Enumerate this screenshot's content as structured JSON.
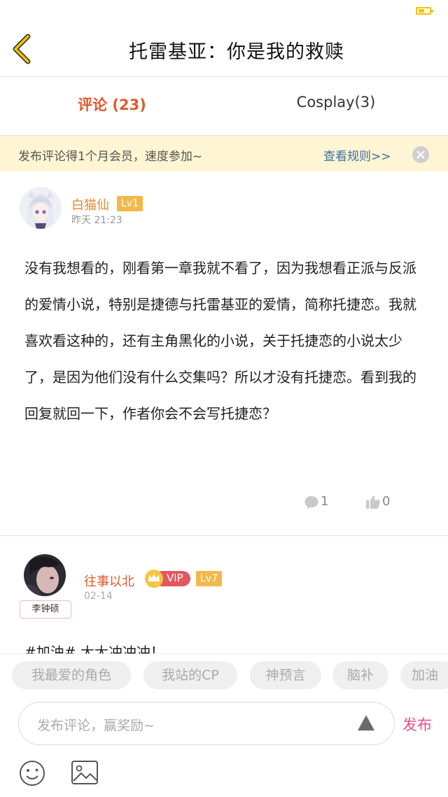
{
  "header": {
    "title": "托雷基亚：你是我的救赎"
  },
  "tabs": {
    "comments": "评论 (23)",
    "cosplay": "Cosplay(3)"
  },
  "notice": {
    "text": "发布评论得1个月会员，速度参加~",
    "link": "查看规则>>"
  },
  "comments": [
    {
      "username": "白猫仙",
      "level": "Lv1",
      "time": "昨天 21:23",
      "body": "没有我想看的，刚看第一章我就不看了，因为我想看正派与反派的爱情小说，特别是捷德与托雷基亚的爱情，简称托捷恋。我就喜欢看这种的，还有主角黑化的小说，关于托捷恋的小说太少了，是因为他们没有什么交集吗？所以才没有托捷恋。看到我的回复就回一下，作者你会不会写托捷恋？",
      "reply_count": "1",
      "like_count": "0"
    },
    {
      "username": "往事以北",
      "vip": "VIP",
      "level": "Lv7",
      "time": "02-14",
      "name_tag": "李钟硕",
      "body": "#加油# 大大冲冲冲！"
    }
  ],
  "bottom": {
    "tags": [
      "我最爱的角色",
      "我站的CP",
      "神预言",
      "脑补",
      "加油"
    ],
    "input_placeholder": "发布评论，赢奖励~",
    "publish_label": "发布"
  },
  "colors": {
    "accent_orange": "#e05a2b",
    "username_orange": "#e88a2e",
    "level_badge": "#f2b84b",
    "notice_bg": "#fdf5d3",
    "link_blue": "#3b6fa8",
    "publish_pink": "#e84d8a",
    "battery": "#f3c400"
  }
}
